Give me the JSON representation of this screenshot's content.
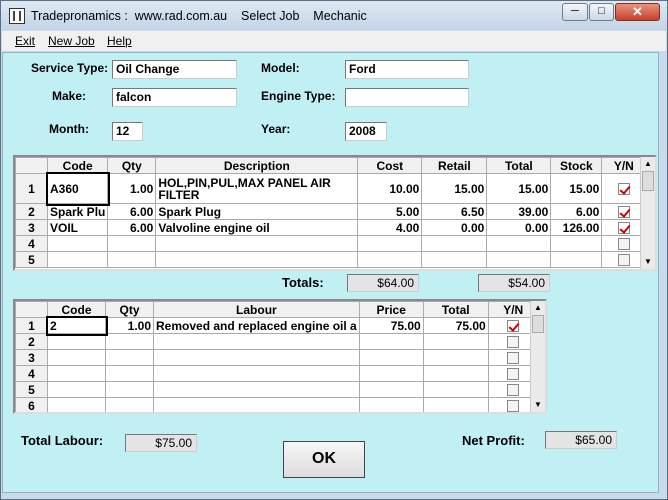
{
  "window": {
    "title": "Tradepronamics :  www.rad.com.au    Select Job    Mechanic",
    "min_glyph": "─",
    "max_glyph": "□",
    "close_glyph": "✕"
  },
  "menu": {
    "items": [
      "Exit",
      "New Job",
      "Help"
    ]
  },
  "form": {
    "service_type_label": "Service Type:",
    "service_type_value": "Oil Change",
    "model_label": "Model:",
    "model_value": "Ford",
    "make_label": "Make:",
    "make_value": "falcon",
    "engine_type_label": "Engine Type:",
    "engine_type_value": "",
    "month_label": "Month:",
    "month_value": "12",
    "year_label": "Year:",
    "year_value": "2008"
  },
  "parts": {
    "headers": [
      "Code",
      "Qty",
      "Description",
      "Cost",
      "Retail",
      "Total",
      "Stock",
      "Y/N"
    ],
    "rows": [
      {
        "n": "1",
        "code": "A360",
        "qty": "1.00",
        "desc": "HOL,PIN,PUL,MAX PANEL AIR FILTER",
        "cost": "10.00",
        "retail": "15.00",
        "total": "15.00",
        "stock": "15.00",
        "yn": true
      },
      {
        "n": "2",
        "code": "Spark Plu",
        "qty": "6.00",
        "desc": "Spark Plug",
        "cost": "5.00",
        "retail": "6.50",
        "total": "39.00",
        "stock": "6.00",
        "yn": true
      },
      {
        "n": "3",
        "code": "VOIL",
        "qty": "6.00",
        "desc": "Valvoline engine oil",
        "cost": "4.00",
        "retail": "0.00",
        "total": "0.00",
        "stock": "126.00",
        "yn": true
      },
      {
        "n": "4",
        "code": "",
        "qty": "",
        "desc": "",
        "cost": "",
        "retail": "",
        "total": "",
        "stock": "",
        "yn": false
      },
      {
        "n": "5",
        "code": "",
        "qty": "",
        "desc": "",
        "cost": "",
        "retail": "",
        "total": "",
        "stock": "",
        "yn": false
      }
    ]
  },
  "totals": {
    "label": "Totals:",
    "cost_total": "$64.00",
    "total_total": "$54.00"
  },
  "labour": {
    "headers": [
      "Code",
      "Qty",
      "Labour",
      "Price",
      "Total",
      "Y/N"
    ],
    "rows": [
      {
        "n": "1",
        "code": "2",
        "qty": "1.00",
        "labour": "Removed and replaced engine oil a",
        "price": "75.00",
        "total": "75.00",
        "yn": true
      },
      {
        "n": "2",
        "code": "",
        "qty": "",
        "labour": "",
        "price": "",
        "total": "",
        "yn": false
      },
      {
        "n": "3",
        "code": "",
        "qty": "",
        "labour": "",
        "price": "",
        "total": "",
        "yn": false
      },
      {
        "n": "4",
        "code": "",
        "qty": "",
        "labour": "",
        "price": "",
        "total": "",
        "yn": false
      },
      {
        "n": "5",
        "code": "",
        "qty": "",
        "labour": "",
        "price": "",
        "total": "",
        "yn": false
      },
      {
        "n": "6",
        "code": "",
        "qty": "",
        "labour": "",
        "price": "",
        "total": "",
        "yn": false
      }
    ]
  },
  "footer": {
    "total_labour_label": "Total Labour:",
    "total_labour_value": "$75.00",
    "net_profit_label": "Net Profit:",
    "net_profit_value": "$65.00",
    "ok_label": "OK"
  },
  "colors": {
    "client_bg": "#c0f0f4",
    "check_red": "#cc0000"
  }
}
